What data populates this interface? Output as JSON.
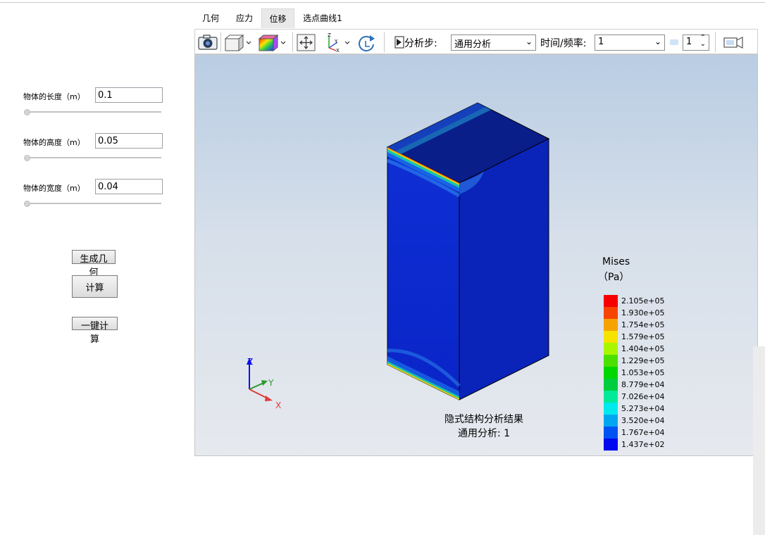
{
  "tabs": [
    "几何",
    "应力",
    "位移",
    "选点曲线1"
  ],
  "active_tab": 2,
  "params": {
    "length": {
      "label": "物体的长度（m）",
      "value": "0.1"
    },
    "height": {
      "label": "物体的高度（m）",
      "value": "0.05"
    },
    "width": {
      "label": "物体的宽度（m）",
      "value": "0.04"
    }
  },
  "buttons": {
    "generate": "生成几何",
    "compute": "计算",
    "one_click": "一键计算"
  },
  "toolbar": {
    "step_label": "分析步:",
    "step_value": "通用分析",
    "time_label": "时间/频率:",
    "time_value": "1",
    "frame_value": "1"
  },
  "viewport": {
    "result_title": "隐式结构分析结果",
    "result_subtitle": "通用分析: 1",
    "axes": {
      "z": "Z",
      "y": "Y",
      "x": "X"
    },
    "legend_title": "Mises",
    "legend_unit": "（Pa）",
    "legend": [
      {
        "color": "#f60000",
        "value": "2.105e+05"
      },
      {
        "color": "#f74400",
        "value": "1.930e+05"
      },
      {
        "color": "#f6a300",
        "value": "1.754e+05"
      },
      {
        "color": "#f6e300",
        "value": "1.579e+05"
      },
      {
        "color": "#a8f600",
        "value": "1.404e+05"
      },
      {
        "color": "#4ce000",
        "value": "1.229e+05"
      },
      {
        "color": "#00d700",
        "value": "1.053e+05"
      },
      {
        "color": "#00ce3e",
        "value": "8.779e+04"
      },
      {
        "color": "#00ea9a",
        "value": "7.026e+04"
      },
      {
        "color": "#00e9ed",
        "value": "5.273e+04"
      },
      {
        "color": "#00a7f0",
        "value": "3.520e+04"
      },
      {
        "color": "#0052f3",
        "value": "1.767e+04"
      },
      {
        "color": "#0008ef",
        "value": "1.437e+02"
      }
    ]
  }
}
